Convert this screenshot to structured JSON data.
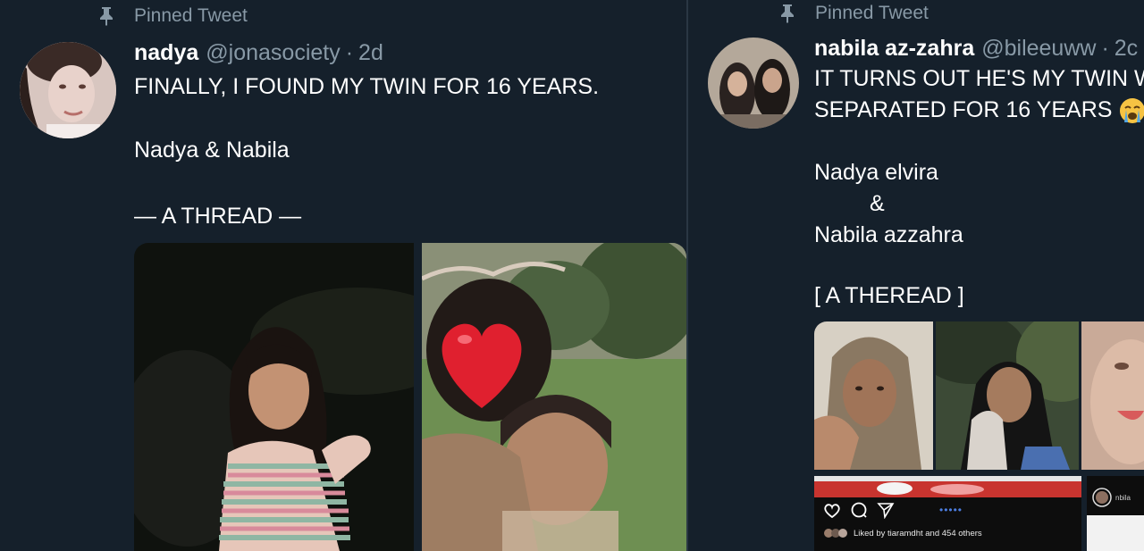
{
  "left_tweet": {
    "pinned_label": "Pinned Tweet",
    "display_name": "nadya",
    "handle": "@jonasociety",
    "separator": "·",
    "age": "2d",
    "line1": "FINALLY, I FOUND MY TWIN FOR 16 YEARS.",
    "line2": "Nadya & Nabila",
    "line3": "— A THREAD —"
  },
  "right_tweet": {
    "pinned_label": "Pinned Tweet",
    "display_name": "nabila az-zahra",
    "handle": "@bileeuww",
    "separator": "·",
    "age": "2c",
    "line1": "IT TURNS OUT HE'S MY TWIN W",
    "line2": "SEPARATED FOR 16 YEARS",
    "line3": "Nadya elvira",
    "line4": "&",
    "line5": "Nabila azzahra",
    "line6": "[ A THEREAD ]",
    "insta_dots": "•••••",
    "insta_likes": "Liked by tiaramdht and 454 others",
    "insta_small_handle": "nbila"
  },
  "colors": {
    "background": "#15202b",
    "muted_text": "#8899a6",
    "primary_text": "#ffffff"
  }
}
